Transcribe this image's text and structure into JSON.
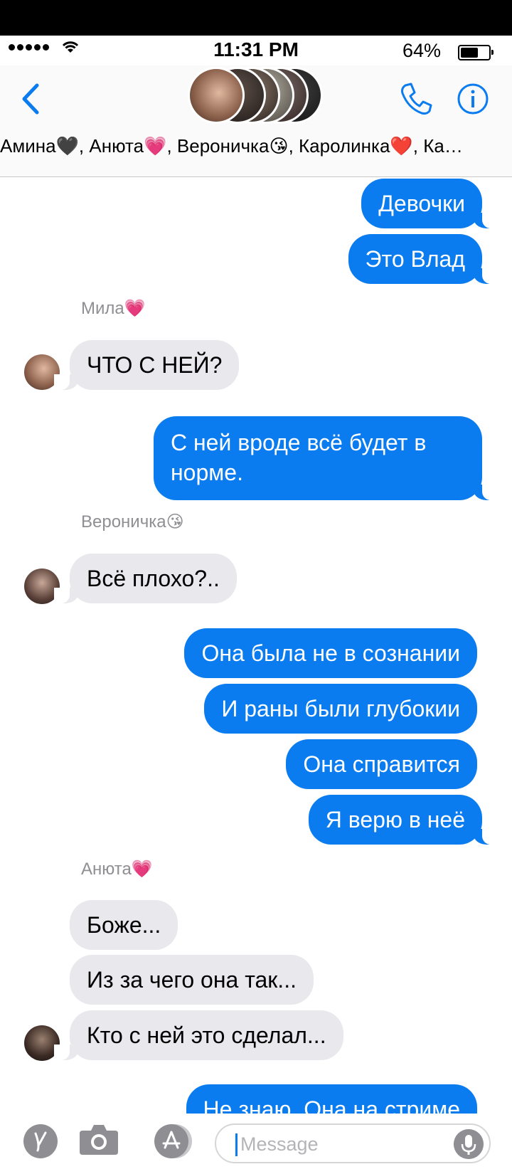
{
  "status_bar": {
    "time": "11:31 PM",
    "battery_percent": "64%",
    "battery_level": 0.64
  },
  "header": {
    "members_text": "Амина🖤, Анюта💗, Вероничка😘, Каролинка❤️, Ка…"
  },
  "colors": {
    "accent": "#0a7cf0",
    "incoming_bubble": "#e8e8ed",
    "sender_label": "#8e8e93"
  },
  "messages": {
    "m1": "Девочки",
    "m2": "Это Влад",
    "sender1": "Мила💗",
    "m3": "ЧТО С НЕЙ?",
    "m4": "С ней вроде всё будет в норме.",
    "sender2": "Вероничка😘",
    "m5": "Всё плохо?..",
    "m6": "Она была не в сознании",
    "m7": "И раны были глубокии",
    "m8": "Она справится",
    "m9": "Я верю в неё",
    "sender3": "Анюта💗",
    "m10": "Боже...",
    "m11": "Из за чего она так...",
    "m12": "Кто с ней это сделал...",
    "m13": "Не знаю. Она на стриме"
  },
  "input_bar": {
    "placeholder": "Message"
  },
  "icons": [
    "back-chevron-icon",
    "phone-icon",
    "info-icon",
    "apps-icon",
    "camera-icon",
    "app-store-icon",
    "microphone-icon"
  ]
}
